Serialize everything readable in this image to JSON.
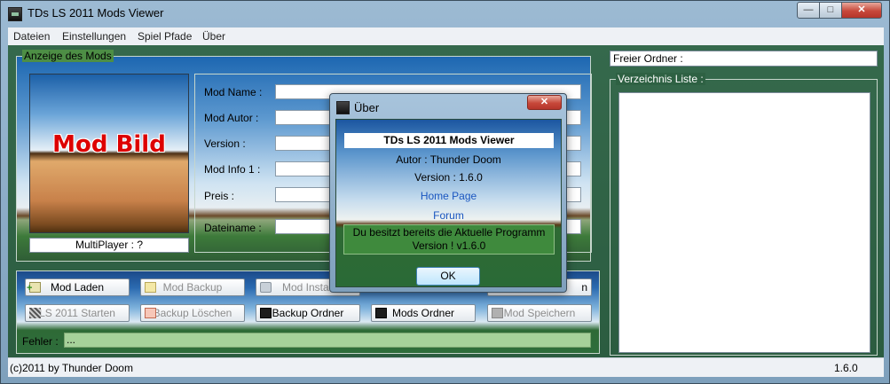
{
  "window": {
    "title": "TDs LS 2011 Mods Viewer"
  },
  "menu": [
    "Dateien",
    "Einstellungen",
    "Spiel Pfade",
    "Über"
  ],
  "mod_display": {
    "group_title": "Anzeige des Mods",
    "image_text": "Mod Bild",
    "multiplayer": "MultiPlayer : ?",
    "fields": [
      {
        "label": "Mod Name :",
        "value": ""
      },
      {
        "label": "Mod Autor :",
        "value": ""
      },
      {
        "label": "Version :",
        "value": ""
      },
      {
        "label": "Mod Info 1 :",
        "value": ""
      },
      {
        "label": "Preis :",
        "value": ""
      },
      {
        "label": "Dateiname :",
        "value": ""
      }
    ]
  },
  "buttons": {
    "mod_laden": "Mod Laden",
    "mod_backup": "Mod Backup",
    "mod_install": "Mod Install",
    "hidden_right": "n",
    "ls_starten": "LS 2011 Starten",
    "backup_loeschen": "Backup  Löschen",
    "backup_ordner": "Backup Ordner",
    "mods_ordner": "Mods Ordner",
    "mod_speichern": "Mod Speichern"
  },
  "error": {
    "label": "Fehler :",
    "value": "..."
  },
  "free_folder": {
    "label": "Freier Ordner :"
  },
  "directory": {
    "title": "Verzeichnis Liste :"
  },
  "status": {
    "left": "(c)2011 by Thunder Doom",
    "right": "1.6.0"
  },
  "about": {
    "title": "Über",
    "app_name": "TDs LS 2011 Mods Viewer",
    "author": "Autor : Thunder Doom",
    "version": "Version : 1.6.0",
    "homepage": "Home Page",
    "forum": "Forum",
    "message": "Du besitzt bereits die Aktuelle Programm Version ! v1.6.0",
    "ok": "OK"
  }
}
